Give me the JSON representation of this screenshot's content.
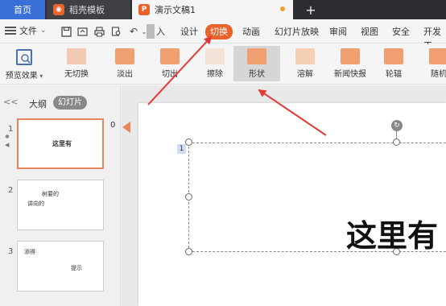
{
  "tabs": {
    "home": "首页",
    "templates": "稻壳模板",
    "document": "演示文稿1",
    "add": "+"
  },
  "menu": {
    "file": "文件",
    "insert": "入",
    "design": "设计",
    "transition": "切换",
    "animation": "动画",
    "slideshow": "幻灯片放映",
    "review": "审阅",
    "view": "视图",
    "security": "安全",
    "developer": "开发工"
  },
  "ribbon": {
    "preview": "预览效果",
    "transitions": [
      {
        "label": "无切换",
        "color": "#f3c9b4"
      },
      {
        "label": "淡出",
        "color": "#f0a070"
      },
      {
        "label": "切出",
        "color": "#f0a070"
      },
      {
        "label": "擦除",
        "color": "#f5e2d8"
      },
      {
        "label": "形状",
        "color": "#f0a070"
      },
      {
        "label": "溶解",
        "color": "#f6d0b4"
      },
      {
        "label": "新闻快报",
        "color": "#f0a070"
      },
      {
        "label": "轮辐",
        "color": "#f0a070"
      },
      {
        "label": "随机",
        "color": "#f0a070"
      }
    ]
  },
  "leftpanel": {
    "collapse": "<<",
    "outline": "大纲",
    "slides_tab": "幻灯片",
    "slides": [
      {
        "num": "1",
        "texts": [
          "这里有"
        ]
      },
      {
        "num": "2",
        "texts": [
          "树要的",
          "讲向的"
        ]
      },
      {
        "num": "3",
        "texts": [
          "添得",
          "提示"
        ]
      }
    ]
  },
  "editor": {
    "marker": "0",
    "placeholder_num": "1",
    "title": "这里有"
  },
  "colors": {
    "accent": "#e8622a",
    "home_tab": "#3a6fd8",
    "arrow": "#e53935"
  }
}
